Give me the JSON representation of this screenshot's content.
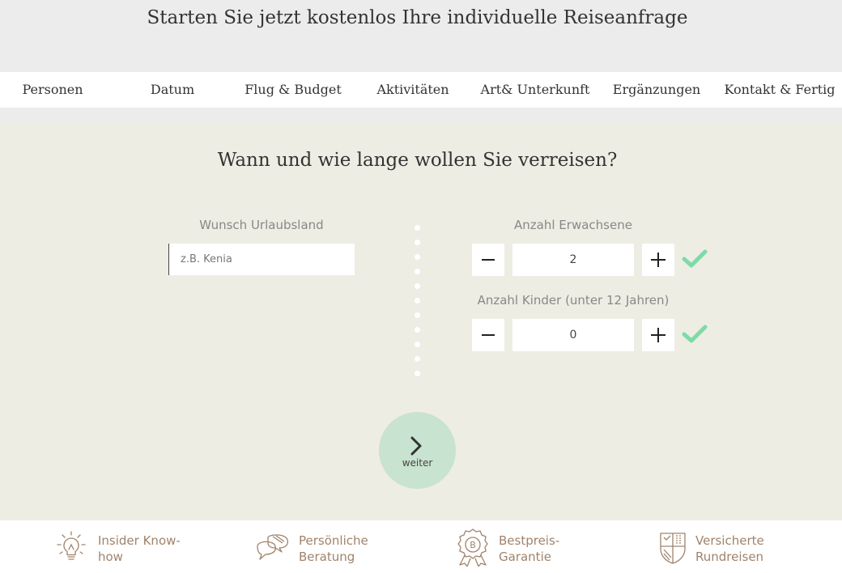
{
  "header": {
    "title": "Starten Sie jetzt kostenlos Ihre individuelle Reiseanfrage"
  },
  "steps": [
    "Personen",
    "Datum",
    "Flug & Budget",
    "Aktivitäten",
    "Art& Unterkunft",
    "Ergänzungen",
    "Kontakt & Fertig"
  ],
  "main": {
    "question": "Wann und wie lange wollen Sie verreisen?",
    "country": {
      "label": "Wunsch Urlaubsland",
      "placeholder": "z.B. Kenia"
    },
    "adults": {
      "label": "Anzahl Erwachsene",
      "value": "2"
    },
    "children": {
      "label": "Anzahl Kinder (unter 12 Jahren)",
      "value": "0"
    },
    "next_label": "weiter"
  },
  "colors": {
    "accent_green": "#7ddba8",
    "brown": "#a0836b",
    "next_bg": "#c8e3cf"
  },
  "footer": {
    "features": [
      {
        "icon": "lightbulb-icon",
        "line1": "Insider Know-",
        "line2": "how"
      },
      {
        "icon": "speech-bubbles-icon",
        "line1": "Persönliche",
        "line2": "Beratung"
      },
      {
        "icon": "badge-icon",
        "line1": "Bestpreis-",
        "line2": "Garantie"
      },
      {
        "icon": "shield-icon",
        "line1": "Versicherte",
        "line2": "Rundreisen"
      }
    ]
  }
}
